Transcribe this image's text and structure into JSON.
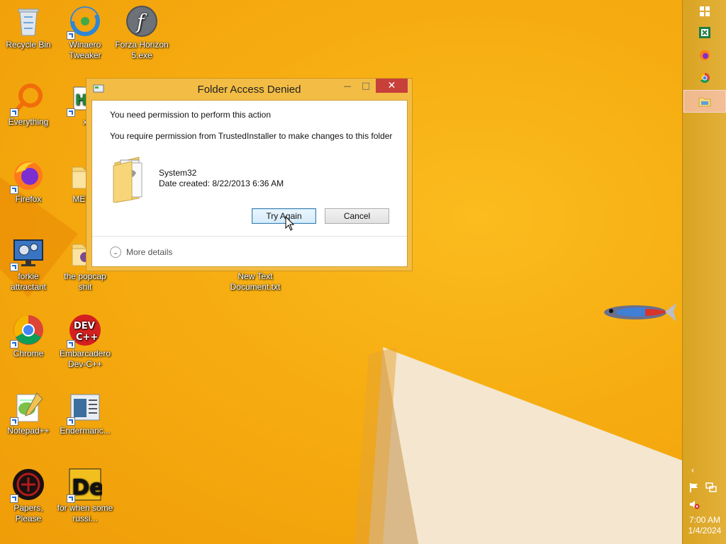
{
  "desktop": {
    "icons": [
      {
        "label": "Recycle Bin",
        "icon": "recycle-bin-icon"
      },
      {
        "label": "Winaero Tweaker",
        "icon": "winaero-tweaker-icon"
      },
      {
        "label": "Forza Horizon 5.exe",
        "icon": "flash-icon"
      },
      {
        "label": "Everything",
        "icon": "everything-search-icon"
      },
      {
        "label": "x",
        "icon": "hxd-icon"
      },
      {
        "label": "Firefox",
        "icon": "firefox-icon"
      },
      {
        "label": "MEMZ",
        "icon": "folder-icon"
      },
      {
        "label": "forkie attractant",
        "icon": "monitor-gear-icon"
      },
      {
        "label": "the popcap shit",
        "icon": "folder-icon"
      },
      {
        "label": "New Text Document.txt",
        "icon": "text-document-icon"
      },
      {
        "label": "Chrome",
        "icon": "chrome-icon"
      },
      {
        "label": "Embarcadero Dev-C++",
        "icon": "devcpp-icon"
      },
      {
        "label": "Notepad++",
        "icon": "notepadpp-icon"
      },
      {
        "label": "Endermanc...",
        "icon": "window-app-icon"
      },
      {
        "label": "Papers, Please",
        "icon": "papers-please-icon"
      },
      {
        "label": "for when some russi...",
        "icon": "de-icon"
      }
    ]
  },
  "taskbar": {
    "clock_time": "7:00 AM",
    "clock_date": "1/4/2024",
    "buttons": [
      "start-icon",
      "excel-icon",
      "firefox-icon",
      "chrome-icon",
      "file-explorer-icon"
    ]
  },
  "dialog": {
    "title": "Folder Access Denied",
    "message_primary": "You need permission to perform this action",
    "message_secondary": "You require permission from TrustedInstaller to make changes to this folder",
    "folder_name": "System32",
    "folder_date": "Date created: 8/22/2013 6:36 AM",
    "try_again_label": "Try Again",
    "cancel_label": "Cancel",
    "more_details_label": "More details",
    "minimize_glyph": "—",
    "maximize_glyph": "□",
    "close_glyph": "✕"
  },
  "colors": {
    "desktop_bg": "#f4a90b",
    "dialog_frame": "#f3bd45",
    "close_button": "#c7403a",
    "taskbar": "#dfab30"
  }
}
